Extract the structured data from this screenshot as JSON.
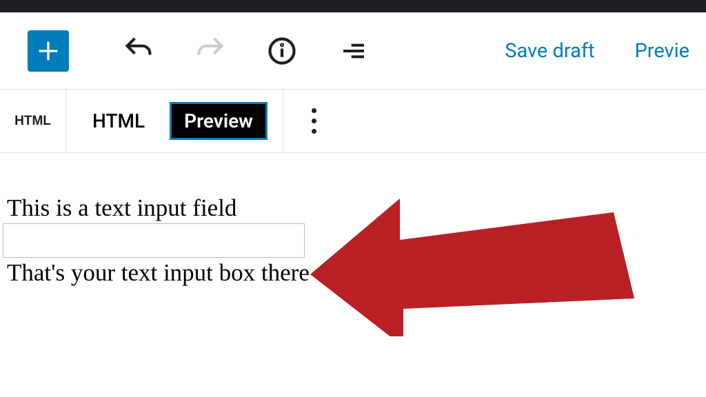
{
  "toolbar": {
    "save_draft": "Save draft",
    "preview": "Previe"
  },
  "block_toolbar": {
    "block_type": "HTML",
    "tab_html": "HTML",
    "tab_preview": "Preview"
  },
  "content": {
    "line1": "This is a text input field",
    "input_value": "",
    "line2": "That's your text input box there"
  },
  "colors": {
    "accent": "#007cba",
    "arrow": "#b92026"
  }
}
